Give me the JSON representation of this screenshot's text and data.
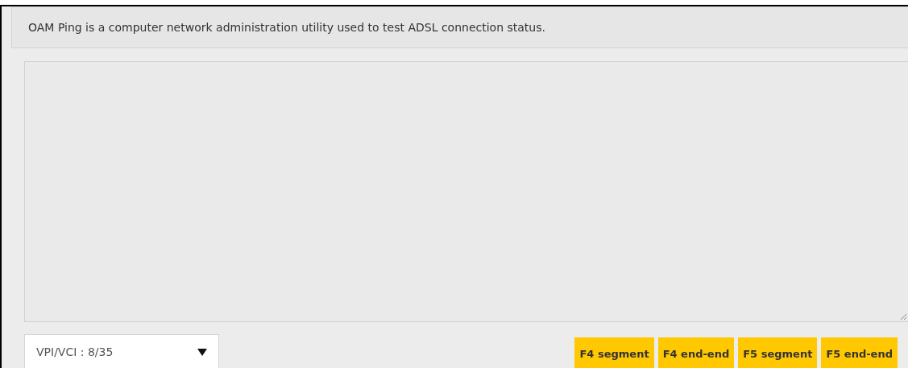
{
  "info": {
    "text": "OAM Ping is a computer network administration utility used to test ADSL connection status."
  },
  "vpi_select": {
    "value": "VPI/VCI : 8/35"
  },
  "buttons": [
    {
      "label": "F4 segment"
    },
    {
      "label": "F4 end-end"
    },
    {
      "label": "F5 segment"
    },
    {
      "label": "F5 end-end"
    }
  ]
}
